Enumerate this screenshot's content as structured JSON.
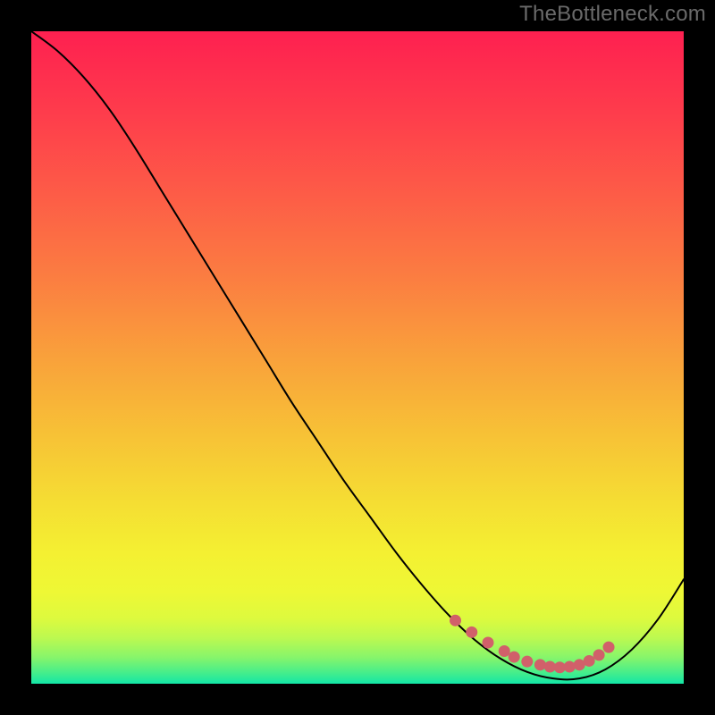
{
  "watermark": "TheBottleneck.com",
  "chart_data": {
    "type": "line",
    "title": "",
    "xlabel": "",
    "ylabel": "",
    "xlim": [
      0,
      100
    ],
    "ylim": [
      0,
      100
    ],
    "series": [
      {
        "name": "curve",
        "color": "#000000",
        "stroke_width": 2,
        "x": [
          0,
          4,
          8,
          12,
          16,
          20,
          24,
          28,
          32,
          36,
          40,
          44,
          48,
          52,
          56,
          60,
          64,
          68,
          72,
          76,
          80,
          84,
          88,
          92,
          96,
          100
        ],
        "values": [
          100,
          97,
          93,
          88,
          82,
          75.5,
          69,
          62.5,
          56,
          49.5,
          43,
          37,
          31,
          25.5,
          20,
          15,
          10.5,
          6.7,
          3.8,
          1.8,
          0.8,
          0.8,
          2.2,
          5.2,
          9.8,
          16
        ]
      },
      {
        "name": "highlight-dots",
        "color": "#d1606a",
        "marker_radius": 6.5,
        "x": [
          65,
          67.5,
          70,
          72.5,
          74,
          76,
          78,
          79.5,
          81,
          82.5,
          84,
          85.5,
          87,
          88.5
        ],
        "values": [
          9.7,
          7.9,
          6.3,
          5.0,
          4.1,
          3.4,
          2.9,
          2.6,
          2.5,
          2.6,
          2.9,
          3.5,
          4.4,
          5.6
        ]
      }
    ],
    "background_gradient": {
      "type": "vertical",
      "stops": [
        {
          "offset": 0.0,
          "color": "#fe2050"
        },
        {
          "offset": 0.12,
          "color": "#fe3b4c"
        },
        {
          "offset": 0.25,
          "color": "#fd5c47"
        },
        {
          "offset": 0.38,
          "color": "#fb7e41"
        },
        {
          "offset": 0.5,
          "color": "#f9a13b"
        },
        {
          "offset": 0.62,
          "color": "#f7c236"
        },
        {
          "offset": 0.72,
          "color": "#f5dd33"
        },
        {
          "offset": 0.8,
          "color": "#f4f032"
        },
        {
          "offset": 0.86,
          "color": "#eef835"
        },
        {
          "offset": 0.9,
          "color": "#ddfa3e"
        },
        {
          "offset": 0.93,
          "color": "#bcf950"
        },
        {
          "offset": 0.96,
          "color": "#86f56b"
        },
        {
          "offset": 0.985,
          "color": "#40ed8e"
        },
        {
          "offset": 1.0,
          "color": "#13e6a7"
        }
      ]
    }
  }
}
